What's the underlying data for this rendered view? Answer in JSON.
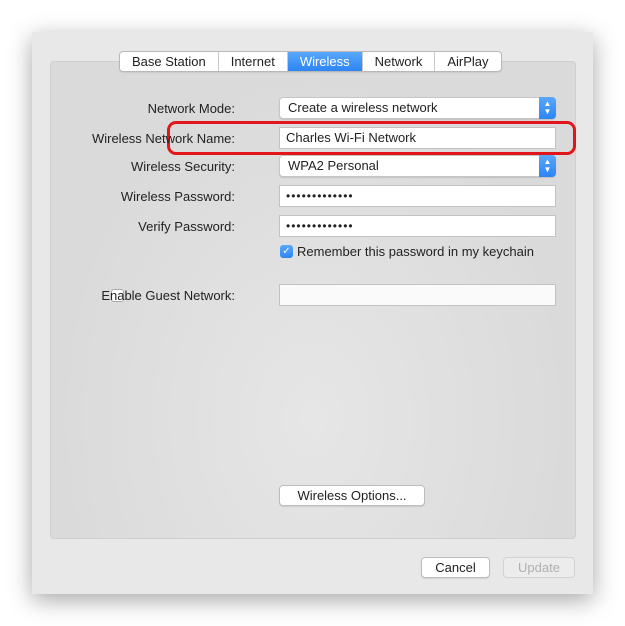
{
  "tabs": [
    {
      "label": "Base Station"
    },
    {
      "label": "Internet"
    },
    {
      "label": "Wireless",
      "active": true
    },
    {
      "label": "Network"
    },
    {
      "label": "AirPlay"
    }
  ],
  "form": {
    "network_mode": {
      "label": "Network Mode:",
      "value": "Create a wireless network"
    },
    "network_name": {
      "label": "Wireless Network Name:",
      "value": "Charles Wi-Fi Network"
    },
    "security": {
      "label": "Wireless Security:",
      "value": "WPA2 Personal"
    },
    "password": {
      "label": "Wireless Password:",
      "value": "•••••••••••••"
    },
    "verify": {
      "label": "Verify Password:",
      "value": "•••••••••••••"
    },
    "remember": {
      "label": "Remember this password in my keychain",
      "checked": true
    },
    "guest": {
      "label": "Enable Guest Network:",
      "checked": false,
      "value": ""
    }
  },
  "buttons": {
    "wireless_options": "Wireless Options...",
    "cancel": "Cancel",
    "update": "Update"
  },
  "colors": {
    "accent": "#2d85f4",
    "highlight": "#e0161b"
  },
  "icons": {
    "select": "up-down-chevron-icon",
    "check": "checkmark-icon"
  }
}
